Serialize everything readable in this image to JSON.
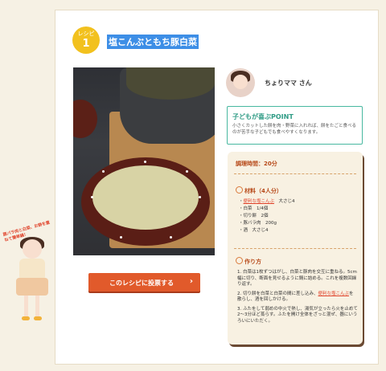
{
  "recipe": {
    "badge_label": "レシピ",
    "badge_number": "1",
    "title": "塩こんぶともち豚白菜",
    "author": "ちょりママ さん",
    "point_title": "子どもが喜ぶPOINT",
    "point_text": "小さくカットした餅を肉・野菜に入れれば、餅をたごと食べるのが苦手な子どもでも食べやすくなります。",
    "cook_time": "調理時間：20分",
    "ingredients_title": "材料（4人分）",
    "ingredients": [
      {
        "link": "便利な塩こんぶ",
        "amount": "大さじ4"
      },
      {
        "name": "白菜",
        "amount": "1/4個"
      },
      {
        "name": "切り餅",
        "amount": "2個"
      },
      {
        "name": "豚バラ肉",
        "amount": "200g"
      },
      {
        "name": "酒",
        "amount": "大さじ4"
      }
    ],
    "steps_title": "作り方",
    "steps": [
      {
        "text": "白菜は1枚ずつはがし、白菜と豚肉を交互に重ねる。5cm幅に切り、断面を見せるように鍋に詰める。これを複数回繰り返す。"
      },
      {
        "before": "切り餅を白菜と白菜の間に差し込み、",
        "link": "便利な塩こんぶ",
        "after": "を散らし、酒を回しかける。"
      },
      {
        "text": "ふたをして弱めの中火で熱し、湯気が立ったら火を止めて2〜3分ほど蒸らす。ふたを開け全体をざっと混ぜ、器にいうろいにいただく。"
      }
    ],
    "post_button": "このレシピに投票する",
    "mascot_caption": "豚バラ肉と白菜、お餅を重ねて簡単鍋！"
  },
  "colors": {
    "accent": "#e15a2b",
    "point_border": "#48b8a0",
    "badge": "#f2c11e"
  }
}
